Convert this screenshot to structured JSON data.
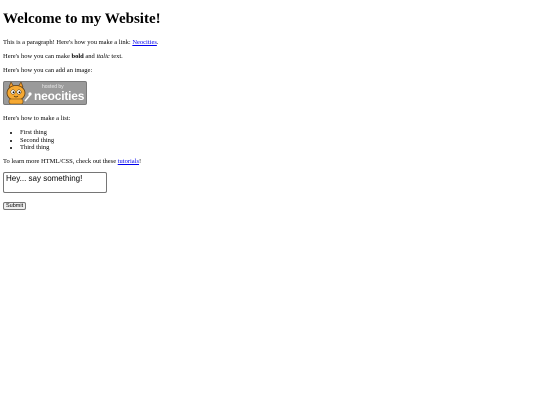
{
  "heading": "Welcome to my Website!",
  "para1": {
    "prefix": "This is a paragraph! Here's how you make a link: ",
    "link": "Neocities",
    "suffix": "."
  },
  "para2": {
    "prefix": "Here's how you can make ",
    "bold": "bold",
    "middle": " and ",
    "italic": "italic",
    "suffix": " text."
  },
  "para3": "Here's how you can add an image:",
  "badge": {
    "small": "hosted by",
    "name": "neocities"
  },
  "para4": "Here's how to make a list:",
  "list": [
    "First thing",
    "Second thing",
    "Third thing"
  ],
  "para5": {
    "prefix": "To learn more HTML/CSS, check out these ",
    "link": "tutorials",
    "suffix": "!"
  },
  "form": {
    "textarea_value": "Hey... say something!",
    "submit_label": "Submit"
  }
}
